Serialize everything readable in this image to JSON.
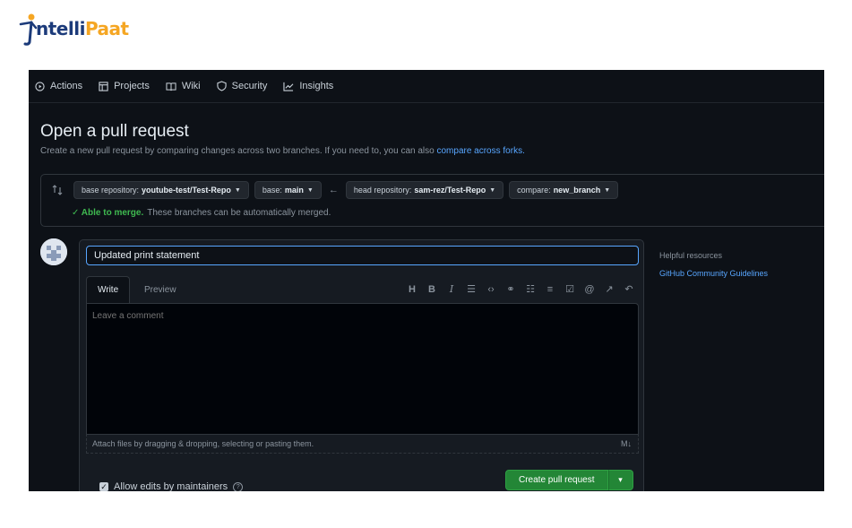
{
  "logo": {
    "text_main": "ntelli",
    "text_accent": "Paat"
  },
  "repo_nav": {
    "items": [
      {
        "label": "Actions",
        "icon": "play-circle-icon"
      },
      {
        "label": "Projects",
        "icon": "table-icon"
      },
      {
        "label": "Wiki",
        "icon": "book-icon"
      },
      {
        "label": "Security",
        "icon": "shield-icon"
      },
      {
        "label": "Insights",
        "icon": "graph-icon"
      }
    ]
  },
  "header": {
    "title": "Open a pull request",
    "subtitle": "Create a new pull request by comparing changes across two branches. If you need to, you can also",
    "subtitle_link": "compare across forks."
  },
  "compare": {
    "base_repo_prefix": "base repository:",
    "base_repo": "youtube-test/Test-Repo",
    "base_prefix": "base:",
    "base": "main",
    "arrow": "←",
    "head_repo_prefix": "head repository:",
    "head_repo": "sam-rez/Test-Repo",
    "compare_prefix": "compare:",
    "compare_branch": "new_branch",
    "merge_status": "✓ Able to merge.",
    "merge_note": "These branches can be automatically merged."
  },
  "form": {
    "title_value": "Updated print statement",
    "tab_write": "Write",
    "tab_preview": "Preview",
    "comment_placeholder": "Leave a comment",
    "attach_text": "Attach files by dragging & dropping, selecting or pasting them.",
    "allow_edits": "Allow edits by maintainers",
    "create_button": "Create pull request",
    "toolbar": [
      "H",
      "B",
      "I",
      "quote",
      "code",
      "link",
      "bulleted-list",
      "numbered-list",
      "task-list",
      "mention",
      "reference",
      "undo"
    ]
  },
  "sidebar": {
    "title": "Helpful resources",
    "link": "GitHub Community Guidelines"
  },
  "colors": {
    "background": "#0d1117",
    "accent_blue": "#58a6ff",
    "button_green": "#238636",
    "success_green": "#3fb950"
  }
}
